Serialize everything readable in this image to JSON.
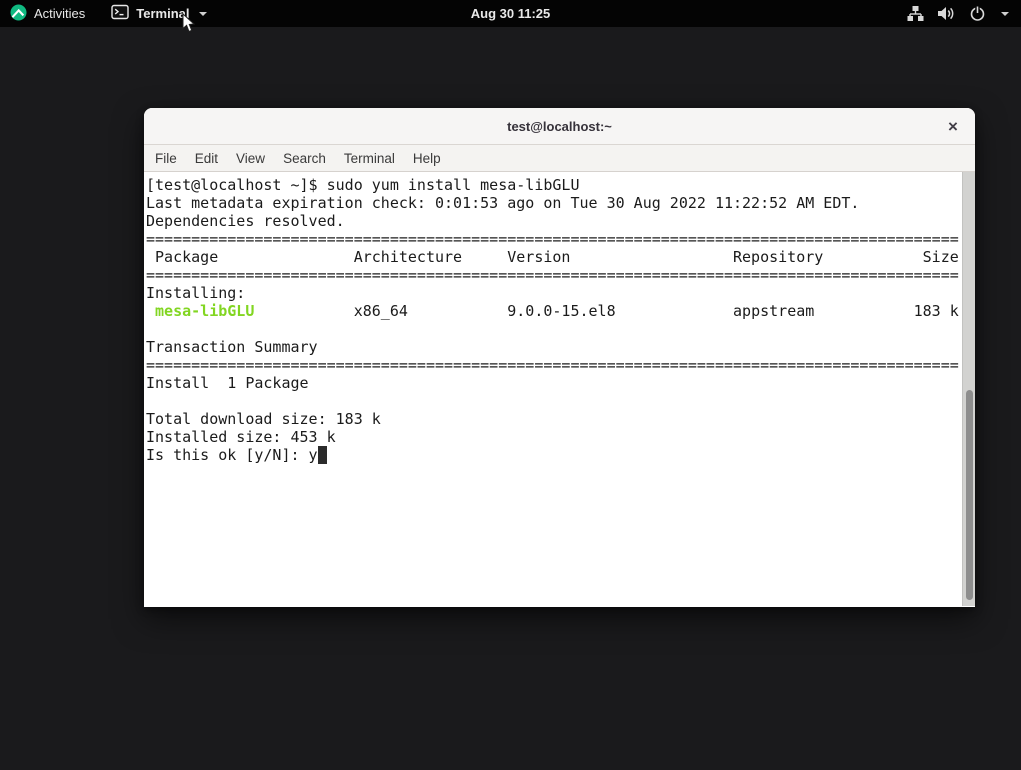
{
  "top_bar": {
    "activities_label": "Activities",
    "app_menu_label": "Terminal",
    "clock": "Aug 30 11:25",
    "icons": [
      "rocky-logo-icon",
      "terminal-app-icon",
      "caret-down-icon",
      "network-wired-icon",
      "volume-icon",
      "power-icon"
    ]
  },
  "window": {
    "title": "test@localhost:~",
    "close_label": "×",
    "menu": [
      "File",
      "Edit",
      "View",
      "Search",
      "Terminal",
      "Help"
    ]
  },
  "terminal": {
    "colors": {
      "background": "#ffffff",
      "foreground": "#1b1b1b",
      "package_green": "#82d622"
    },
    "lines": [
      [
        {
          "t": "[test@localhost ~]$ sudo yum install mesa-libGLU"
        }
      ],
      [
        {
          "t": "Last metadata expiration check: 0:01:53 ago on Tue 30 Aug 2022 11:22:52 AM EDT."
        }
      ],
      [
        {
          "t": "Dependencies resolved."
        }
      ],
      [
        {
          "t": "=========================================================================================="
        }
      ],
      [
        {
          "t": " Package               Architecture     Version                  Repository           Size"
        }
      ],
      [
        {
          "t": "=========================================================================================="
        }
      ],
      [
        {
          "t": "Installing:"
        }
      ],
      [
        {
          "t": " "
        },
        {
          "t": "mesa-libGLU",
          "c": "seg-green"
        },
        {
          "t": "           x86_64           9.0.0-15.el8             appstream           183 k"
        }
      ],
      [
        {
          "t": ""
        }
      ],
      [
        {
          "t": "Transaction Summary"
        }
      ],
      [
        {
          "t": "=========================================================================================="
        }
      ],
      [
        {
          "t": "Install  1 Package"
        }
      ],
      [
        {
          "t": ""
        }
      ],
      [
        {
          "t": "Total download size: 183 k"
        }
      ],
      [
        {
          "t": "Installed size: 453 k"
        }
      ],
      [
        {
          "t": "Is this ok [y/N]: y"
        },
        {
          "t": " ",
          "c": "cursor"
        }
      ]
    ]
  }
}
